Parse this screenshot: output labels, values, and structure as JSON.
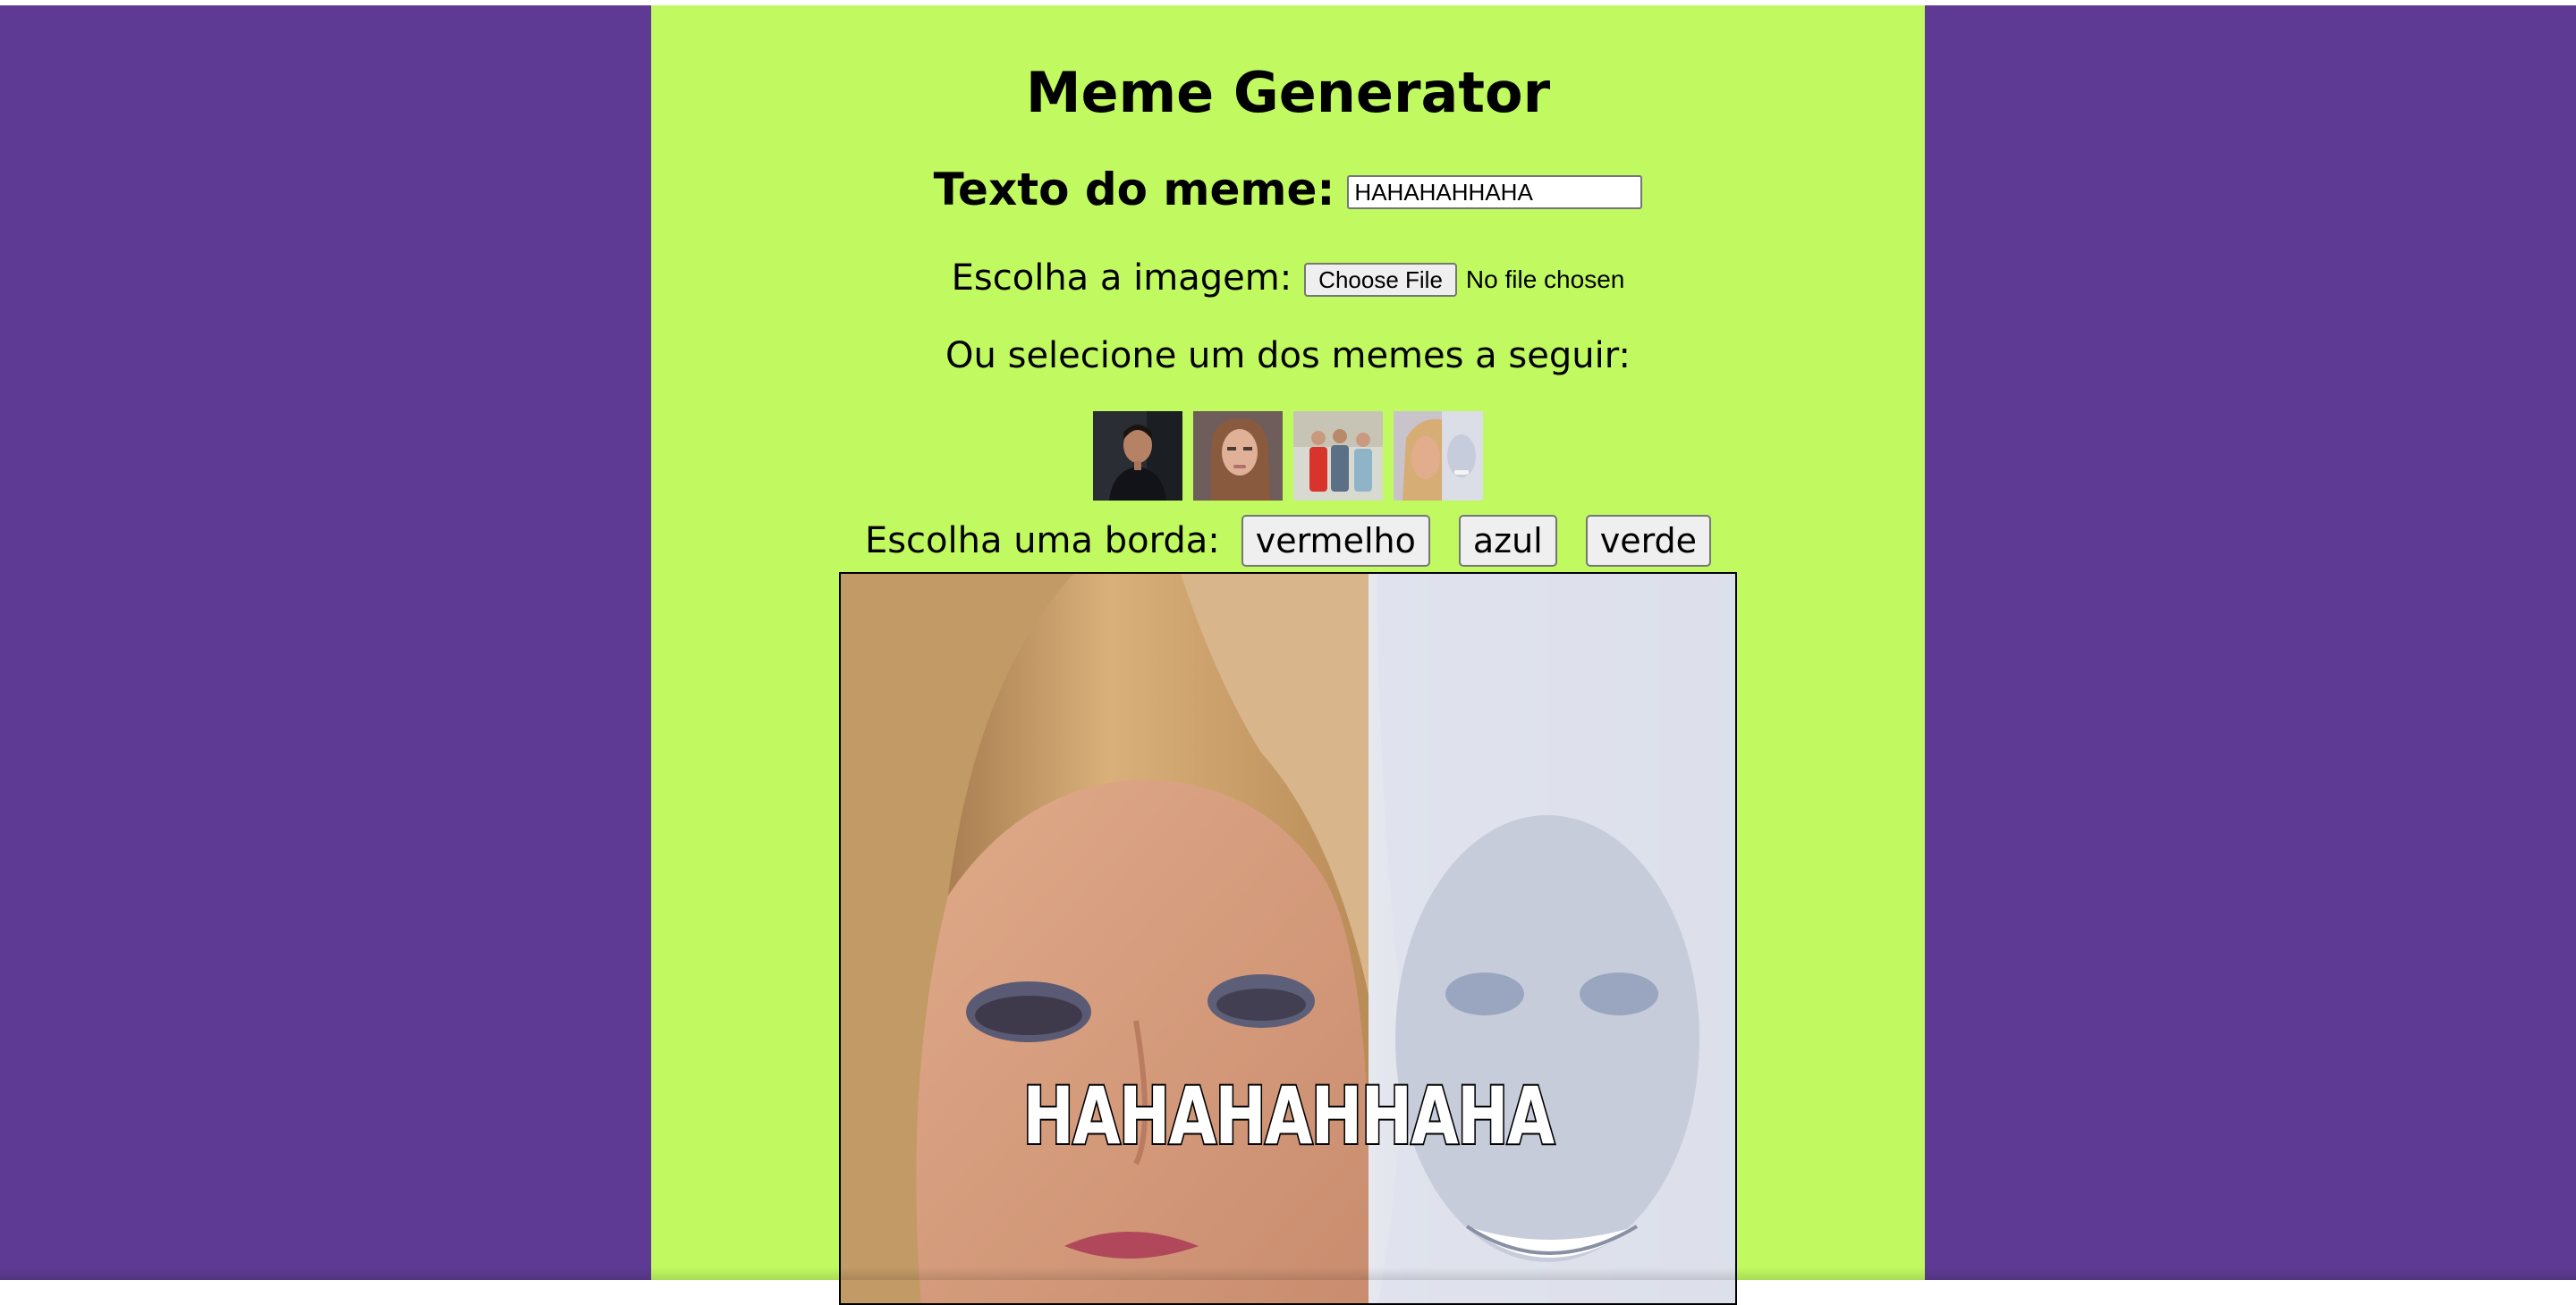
{
  "page": {
    "background_color": "#5e3a94",
    "panel_color": "#c0f960"
  },
  "header": {
    "title": "Meme Generator"
  },
  "form": {
    "text_label": "Texto do meme:",
    "text_value": "HAHAHAHHAHA",
    "image_label": "Escolha a imagem:",
    "choose_file_label": "Choose File",
    "file_status": "No file chosen",
    "select_label": "Ou selecione um dos memes a seguir:"
  },
  "thumbnails": [
    {
      "name": "meme-thumb-man-dark",
      "icon": "man-portrait"
    },
    {
      "name": "meme-thumb-woman-brown",
      "icon": "woman-portrait"
    },
    {
      "name": "meme-thumb-group",
      "icon": "group-photo"
    },
    {
      "name": "meme-thumb-blonde-laugh",
      "icon": "blonde-portrait"
    }
  ],
  "borders": {
    "label": "Escolha uma borda:",
    "buttons": [
      "vermelho",
      "azul",
      "verde"
    ]
  },
  "meme": {
    "caption": "HAHAHAHHAHA"
  }
}
